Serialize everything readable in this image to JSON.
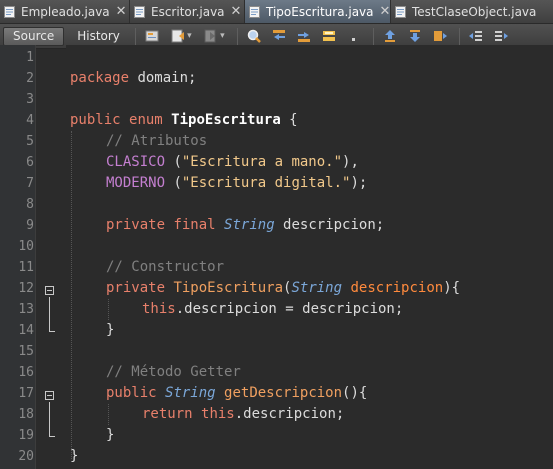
{
  "tabs": [
    {
      "label": "Empleado.java",
      "active": false
    },
    {
      "label": "Escritor.java",
      "active": false
    },
    {
      "label": "TipoEscritura.java",
      "active": true
    },
    {
      "label": "TestClaseObject.java",
      "active": false
    }
  ],
  "toolbar": {
    "source_label": "Source",
    "history_label": "History"
  },
  "editor": {
    "line_numbers": [
      "1",
      "2",
      "3",
      "4",
      "5",
      "6",
      "7",
      "8",
      "9",
      "10",
      "11",
      "12",
      "13",
      "14",
      "15",
      "16",
      "17",
      "18",
      "19",
      "20"
    ],
    "tokens": {
      "l2_kw": "package",
      "l2_rest": " domain;",
      "l4_kw1": "public",
      "l4_kw2": "enum",
      "l4_cls": "TipoEscritura",
      "l4_rest": " {",
      "l5_cm": "// Atributos",
      "l6_const": "CLASICO",
      "l6_open": " (",
      "l6_str": "\"Escritura a mano.\"",
      "l6_close": "),",
      "l7_const": "MODERNO",
      "l7_open": " (",
      "l7_str": "\"Escritura digital.\"",
      "l7_close": ");",
      "l9_kw1": "private",
      "l9_kw2": "final",
      "l9_ty": "String",
      "l9_rest": " descripcion;",
      "l11_cm": "// Constructor",
      "l12_kw": "private",
      "l12_name": "TipoEscritura",
      "l12_open": "(",
      "l12_ty": "String",
      "l12_arg": "descripcion",
      "l12_close": "){",
      "l13_kw": "this",
      "l13_rest": ".descripcion = descripcion;",
      "l14": "}",
      "l16_cm": "// Método Getter",
      "l17_kw": "public",
      "l17_ty": "String",
      "l17_name": "getDescripcion",
      "l17_rest": "(){",
      "l18_kw1": "return",
      "l18_kw2": "this",
      "l18_rest": ".descripcion;",
      "l19": "}",
      "l20": "}"
    }
  },
  "colors": {
    "keyword": "#e8806b",
    "type": "#7ba7d8",
    "comment": "#808080",
    "string": "#f2c98b",
    "constant": "#c47fd0",
    "background": "#2b2b2b"
  },
  "icons": {
    "file_tab": "java-file-icon",
    "last_edit": "last-edit-icon",
    "back": "back-nav-icon",
    "forward": "forward-nav-icon",
    "find": "find-icon",
    "find_prev": "find-previous-icon",
    "find_next": "find-next-icon",
    "toggle_highlight": "toggle-highlight-icon",
    "rect_select": "rectangular-selection-icon",
    "prev_bookmark": "previous-bookmark-icon",
    "next_bookmark": "next-bookmark-icon",
    "toggle_bookmark": "toggle-bookmark-icon",
    "shift_left": "shift-left-icon",
    "shift_right": "shift-right-icon"
  }
}
